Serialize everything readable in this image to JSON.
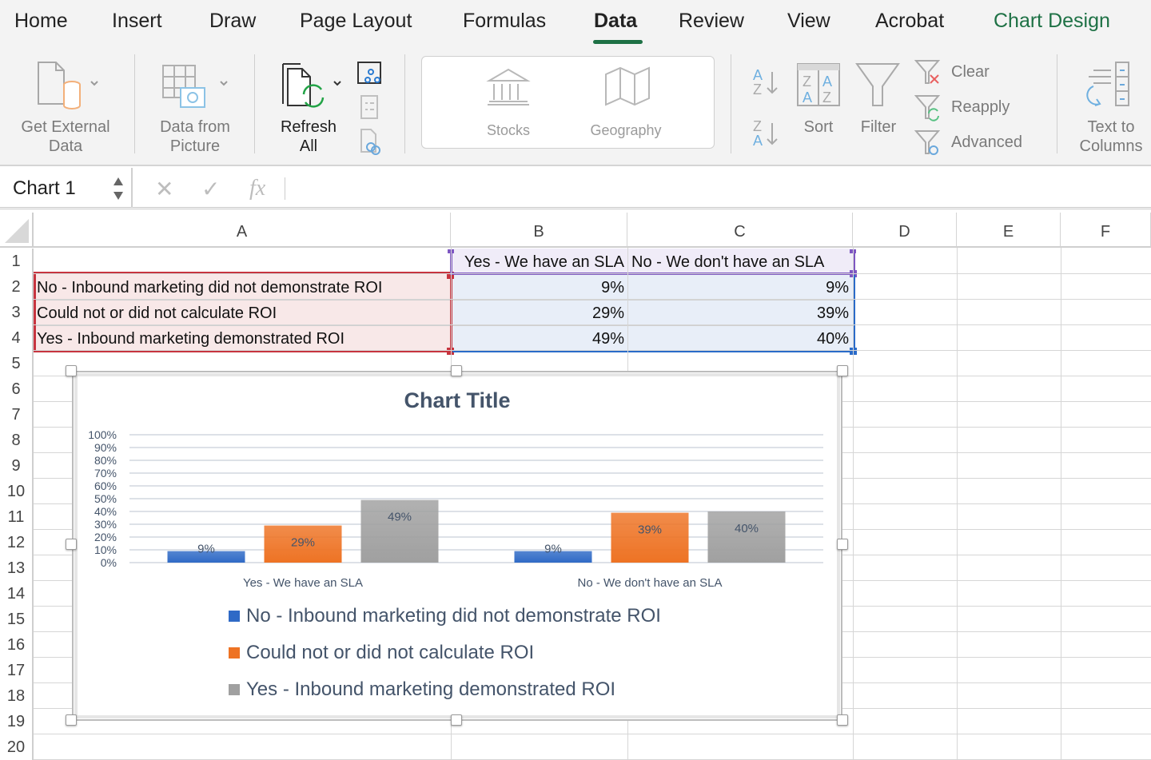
{
  "ribbon_tabs": [
    {
      "label": "Home"
    },
    {
      "label": "Insert"
    },
    {
      "label": "Draw"
    },
    {
      "label": "Page Layout"
    },
    {
      "label": "Formulas"
    },
    {
      "label": "Data",
      "active": true
    },
    {
      "label": "Review"
    },
    {
      "label": "View"
    },
    {
      "label": "Acrobat"
    },
    {
      "label": "Chart Design",
      "contextual": true
    }
  ],
  "ribbon": {
    "get_external_data": [
      "Get External",
      "Data"
    ],
    "data_from_picture": [
      "Data from",
      "Picture"
    ],
    "refresh_all": [
      "Refresh",
      "All"
    ],
    "stocks": "Stocks",
    "geography": "Geography",
    "sort": "Sort",
    "filter": "Filter",
    "clear": "Clear",
    "reapply": "Reapply",
    "advanced": "Advanced",
    "text_to_columns": [
      "Text to",
      "Columns"
    ]
  },
  "formula_bar": {
    "name_box": "Chart 1",
    "fx": "fx",
    "formula": ""
  },
  "sheet": {
    "columns": [
      "A",
      "B",
      "C",
      "D",
      "E",
      "F"
    ],
    "rows": [
      "1",
      "2",
      "3",
      "4",
      "5",
      "6",
      "7",
      "8",
      "9",
      "10",
      "11",
      "12",
      "13",
      "14",
      "15",
      "16",
      "17",
      "18",
      "19",
      "20"
    ],
    "cells": {
      "B1": "Yes - We have an SLA",
      "C1": "No - We don't have an SLA",
      "A2": "No - Inbound marketing did not demonstrate ROI",
      "A3": "Could not or did not calculate ROI",
      "A4": "Yes - Inbound marketing demonstrated ROI",
      "B2": "9%",
      "C2": "9%",
      "B3": "29%",
      "C3": "39%",
      "B4": "49%",
      "C4": "40%"
    }
  },
  "chart_data": {
    "type": "bar",
    "title": "Chart Title",
    "categories": [
      "Yes - We have an SLA",
      "No - We don't have an SLA"
    ],
    "series": [
      {
        "name": "No - Inbound marketing did not demonstrate ROI",
        "values": [
          9,
          9
        ],
        "color": "#2f6ac6"
      },
      {
        "name": "Could not or did not calculate ROI",
        "values": [
          29,
          39
        ],
        "color": "#ee7324"
      },
      {
        "name": "Yes - Inbound marketing demonstrated ROI",
        "values": [
          49,
          40
        ],
        "color": "#a0a0a0"
      }
    ],
    "value_suffix": "%",
    "yticks": [
      "0%",
      "10%",
      "20%",
      "30%",
      "40%",
      "50%",
      "60%",
      "70%",
      "80%",
      "90%",
      "100%"
    ],
    "ylim": [
      0,
      100
    ],
    "xlabel": "",
    "ylabel": "",
    "grid": true,
    "legend_position": "bottom",
    "data_labels": true
  },
  "colors": {
    "accent_green": "#1e7145",
    "range_red": "#c7343f",
    "range_purple": "#7e57c2",
    "range_blue": "#2a6bc9",
    "chart_text": "#44546a"
  }
}
